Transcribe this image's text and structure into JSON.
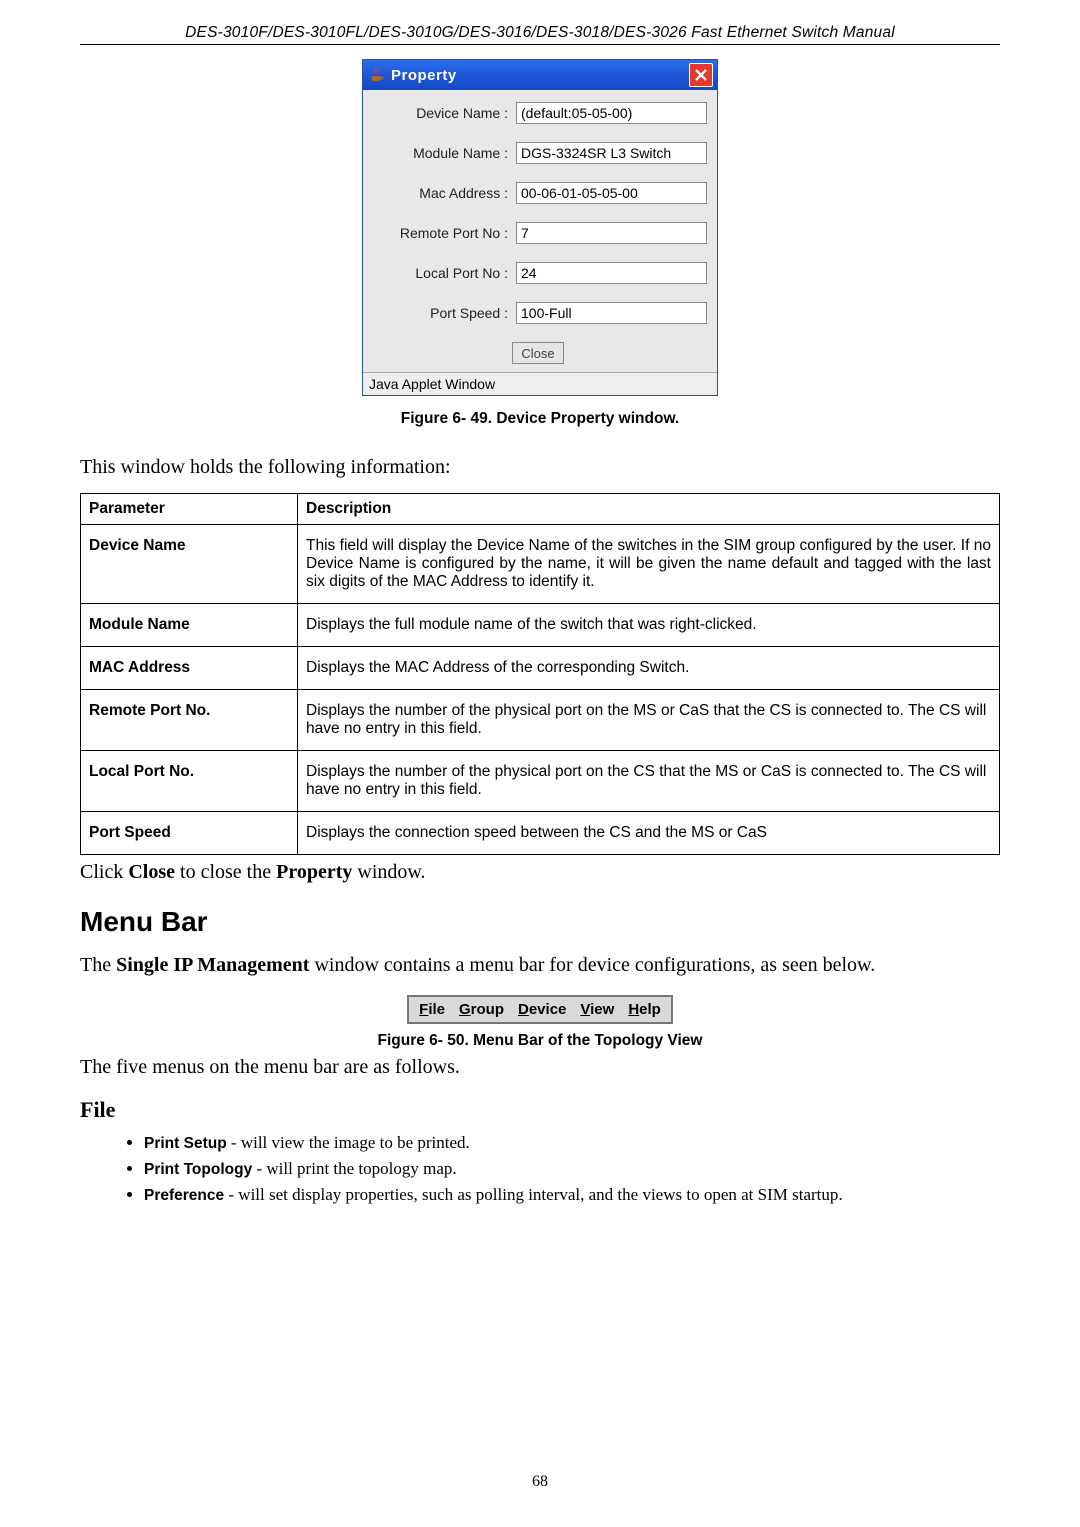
{
  "header": "DES-3010F/DES-3010FL/DES-3010G/DES-3016/DES-3018/DES-3026 Fast Ethernet Switch Manual",
  "property_window": {
    "title": "Property",
    "close_x": "×",
    "rows": [
      {
        "label": "Device Name :",
        "value": "(default:05-05-00)"
      },
      {
        "label": "Module Name :",
        "value": "DGS-3324SR L3 Switch"
      },
      {
        "label": "Mac Address :",
        "value": "00-06-01-05-05-00"
      },
      {
        "label": "Remote Port No :",
        "value": "7"
      },
      {
        "label": "Local Port No :",
        "value": "24"
      },
      {
        "label": "Port Speed :",
        "value": "100-Full"
      }
    ],
    "close_label": "Close",
    "status": "Java Applet Window"
  },
  "fig49_caption": "Figure 6- 49. Device Property window.",
  "intro_text": "This window holds the following information:",
  "param_table": {
    "head_param": "Parameter",
    "head_desc": "Description",
    "rows": [
      {
        "param": "Device Name",
        "desc": "This field will display the Device Name of the switches in the SIM group configured by the user. If no Device Name is configured by the name, it will be given the name default and tagged with the last six digits of the MAC Address to identify it."
      },
      {
        "param": "Module Name",
        "desc": "Displays the full module name of the switch that was right-clicked."
      },
      {
        "param": "MAC Address",
        "desc": "Displays the MAC Address of the corresponding Switch."
      },
      {
        "param": "Remote Port No.",
        "desc": "Displays the number of the physical port on the MS or CaS that the CS is connected to. The CS will have no entry in this field."
      },
      {
        "param": "Local Port No.",
        "desc": "Displays the number of the physical port on the CS that the MS or CaS is connected to. The CS will have no entry in this field."
      },
      {
        "param": "Port Speed",
        "desc": "Displays the connection speed between the CS and the MS or CaS"
      }
    ]
  },
  "close_sentence": {
    "pre": "Click ",
    "b1": "Close",
    "mid": " to close the ",
    "b2": "Property",
    "post": " window."
  },
  "menubar_heading": "Menu Bar",
  "menubar_intro_pre": "The ",
  "menubar_intro_bold": "Single IP Management",
  "menubar_intro_post": " window contains a menu bar for device configurations, as seen below.",
  "menubar": {
    "items": [
      {
        "u": "F",
        "rest": "ile"
      },
      {
        "u": "G",
        "rest": "roup"
      },
      {
        "u": "D",
        "rest": "evice"
      },
      {
        "u": "V",
        "rest": "iew"
      },
      {
        "u": "H",
        "rest": "elp"
      }
    ]
  },
  "fig50_caption": "Figure 6- 50. Menu Bar of the Topology View",
  "five_menus_line": "The five menus on the menu bar are as follows.",
  "file_heading": "File",
  "file_items": [
    {
      "label": "Print Setup",
      "desc": " - will view the image to be printed."
    },
    {
      "label": "Print Topology",
      "desc": " - will print the topology map."
    },
    {
      "label": "Preference",
      "desc": " - will set display properties, such as polling interval, and the views to open at SIM startup."
    }
  ],
  "page_number": "68"
}
